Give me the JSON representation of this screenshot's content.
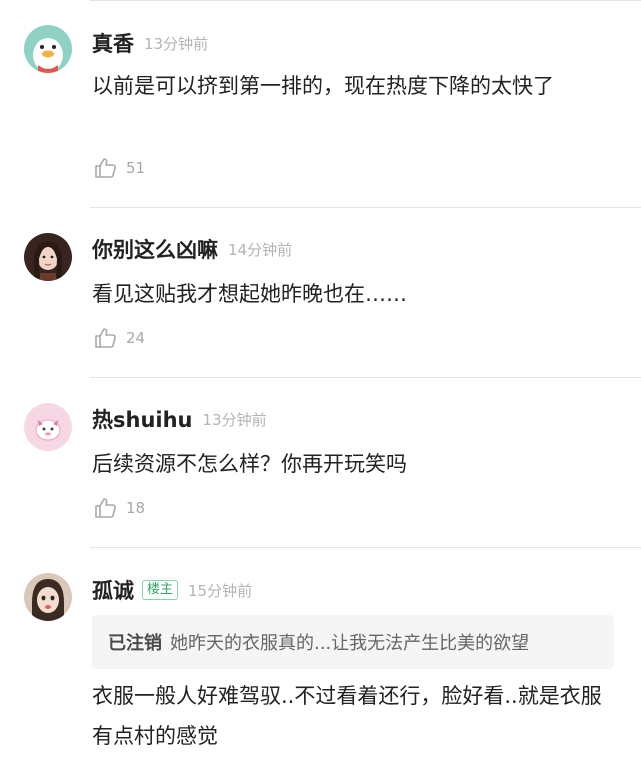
{
  "comments": [
    {
      "username": "真香",
      "time": "13分钟前",
      "text": "以前是可以挤到第一排的，现在热度下降的太快了",
      "likes": "51",
      "avatar_icon": "duck-avatar-icon"
    },
    {
      "username": "你别这么凶嘛",
      "time": "14分钟前",
      "text": "看见这贴我才想起她昨晚也在……",
      "likes": "24",
      "avatar_icon": "girl-avatar-icon"
    },
    {
      "username": "热shuihu",
      "time": "13分钟前",
      "text": "后续资源不怎么样？你再开玩笑吗",
      "likes": "18",
      "avatar_icon": "pink-cartoon-avatar-icon"
    },
    {
      "username": "孤诚",
      "badge": "楼主",
      "time": "15分钟前",
      "quote": {
        "user": "已注销",
        "text": "她昨天的衣服真的...让我无法产生比美的欲望"
      },
      "text": "衣服一般人好难驾驭..不过看着还行，脸好看..就是衣服有点村的感觉",
      "avatar_icon": "face-avatar-icon"
    }
  ],
  "colors": {
    "badge_green": "#32a868",
    "time_gray": "#b4b4b4",
    "quote_bg": "#f5f5f5"
  }
}
